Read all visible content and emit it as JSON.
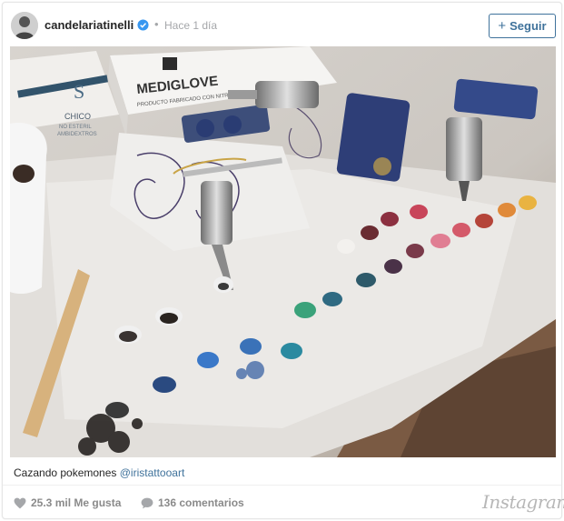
{
  "post": {
    "username": "candelariatinelli",
    "verified": true,
    "separator": "•",
    "time": "Hace 1 día",
    "follow_label": "Seguir"
  },
  "photo": {
    "box1_letter": "S",
    "box1_text1": "CHICO",
    "box1_text2": "NO ESTERIL",
    "box1_text3": "AMBIDEXTROS",
    "box2_brand": "MEDIGLOVE",
    "box2_text": "PRODUCTO FABRICADO CON NITRILO COLOR NEGRO"
  },
  "caption": {
    "text": "Cazando pokemones ",
    "mention": "@iristattooart"
  },
  "footer": {
    "likes": "25.3 mil Me gusta",
    "comments": "136 comentarios",
    "brand": "Instagram"
  },
  "colors": {
    "accent": "#3f729b",
    "muted": "#a5a7aa",
    "verified": "#3897f0"
  }
}
